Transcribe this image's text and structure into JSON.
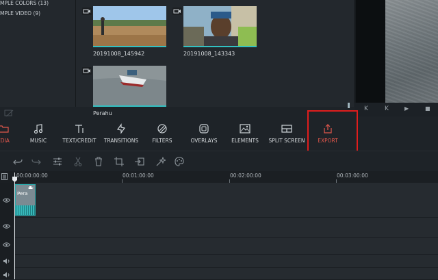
{
  "library": {
    "items": [
      {
        "label": "MPLE COLORS (13)"
      },
      {
        "label": "MPLE VIDEO (9)"
      }
    ]
  },
  "media": {
    "clips": [
      {
        "name": "20191008_145942",
        "icon": "video-camera-icon"
      },
      {
        "name": "20191008_143343",
        "icon": "video-camera-icon"
      },
      {
        "name": "Perahu",
        "icon": "video-camera-icon"
      }
    ]
  },
  "player": {
    "buttons": [
      {
        "icon": "prev-frame-icon",
        "glyph": "K"
      },
      {
        "icon": "step-back-icon",
        "glyph": "K"
      },
      {
        "icon": "play-icon",
        "glyph": "▶"
      },
      {
        "icon": "stop-icon",
        "glyph": "■"
      }
    ]
  },
  "toolbar": {
    "tools": [
      {
        "label": "EDIA",
        "icon": "folder-icon",
        "active": true
      },
      {
        "label": "MUSIC",
        "icon": "music-note-icon"
      },
      {
        "label": "TEXT/CREDIT",
        "icon": "text-icon"
      },
      {
        "label": "TRANSITIONS",
        "icon": "transitions-icon"
      },
      {
        "label": "FILTERS",
        "icon": "filters-icon"
      },
      {
        "label": "OVERLAYS",
        "icon": "overlays-icon"
      },
      {
        "label": "ELEMENTS",
        "icon": "elements-icon"
      },
      {
        "label": "SPLIT SCREEN",
        "icon": "split-screen-icon"
      },
      {
        "label": "EXPORT",
        "icon": "export-icon",
        "active": true
      }
    ],
    "active_color": "#e2574c",
    "highlight_color": "#e11d1d"
  },
  "edit_tools": [
    "undo-icon",
    "redo-icon",
    "adjust-icon",
    "cut-icon",
    "delete-icon",
    "crop-icon",
    "detach-audio-icon",
    "wand-icon",
    "color-icon"
  ],
  "timeline": {
    "timecodes": [
      "00:00:00:00",
      "00:01:00:00",
      "00:02:00:00",
      "00:03:00:00"
    ],
    "clip": {
      "label": "Pera"
    },
    "accent_color": "#31c1c3"
  }
}
